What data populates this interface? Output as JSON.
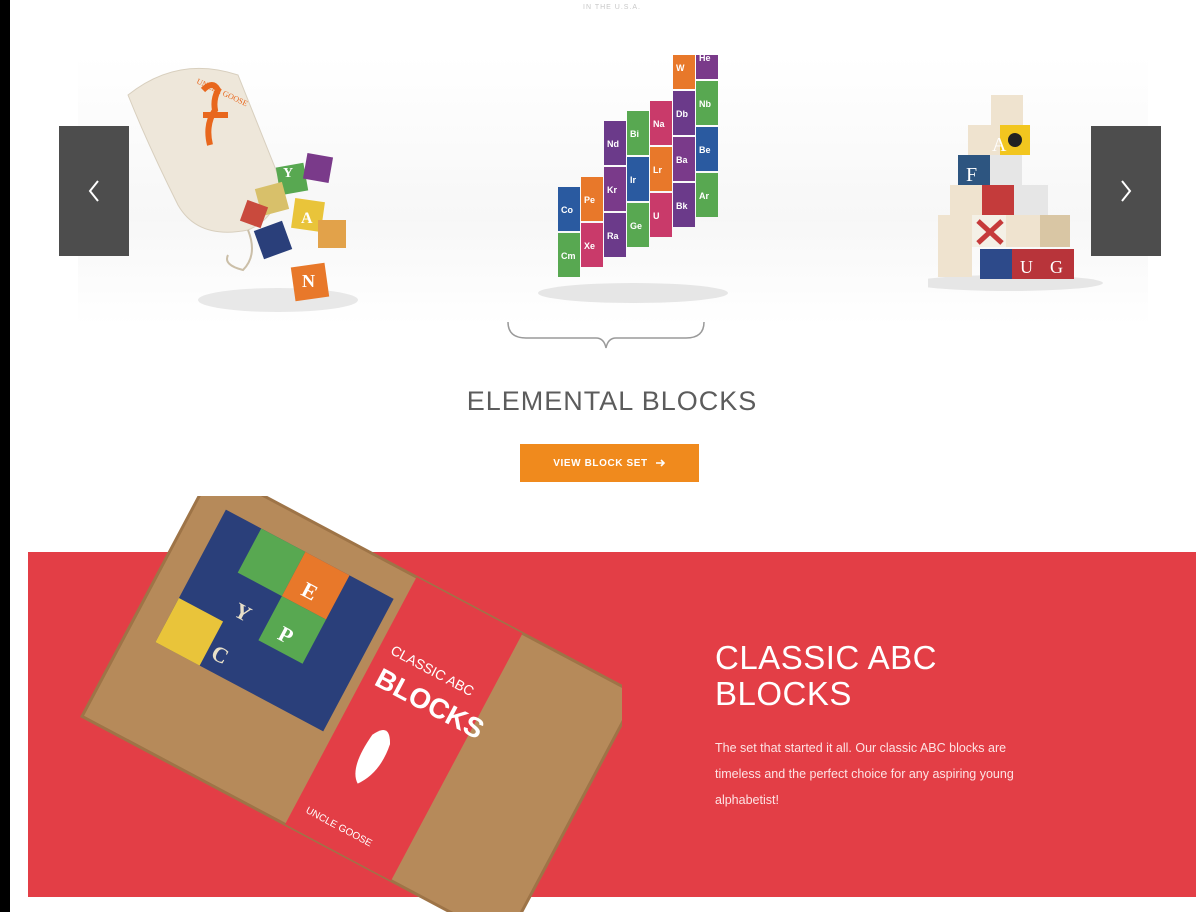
{
  "top_label": "IN THE U.S.A.",
  "carousel": {
    "prev_icon": "chevron-left-icon",
    "next_icon": "chevron-right-icon",
    "slides": [
      {
        "name": "abc-bag-slide",
        "block_letters": [
          "Y",
          "A",
          "N"
        ]
      },
      {
        "name": "elemental-blocks-slide",
        "block_letters": [
          "W",
          "He",
          "Nd",
          "Bi",
          "Na",
          "Db",
          "Nb",
          "Co",
          "Pe",
          "Kr",
          "Ir",
          "Lr",
          "Ba",
          "Be",
          "Cm",
          "Xe",
          "Ra",
          "Ge",
          "U",
          "Bk",
          "Ar"
        ]
      },
      {
        "name": "nautical-blocks-slide",
        "block_letters": [
          "A",
          "F",
          "U",
          "G"
        ]
      }
    ]
  },
  "featured_set": {
    "title": "ELEMENTAL BLOCKS",
    "button_label": "VIEW BLOCK SET",
    "button_icon": "arrow-right-icon"
  },
  "classic": {
    "title": "CLASSIC ABC BLOCKS",
    "description": "The set that started it all. Our classic ABC blocks are timeless and the perfect choice for any aspiring young alphabetist!",
    "box_brand": "UNCLE GOOSE",
    "box_title_top": "CLASSIC ABC",
    "box_title_main": "BLOCKS",
    "box_block_letters": [
      "Y",
      "E",
      "P",
      "C"
    ]
  },
  "colors": {
    "accent_orange": "#f08a1d",
    "section_red": "#e33e46",
    "nav_gray": "#4d4d4d"
  }
}
